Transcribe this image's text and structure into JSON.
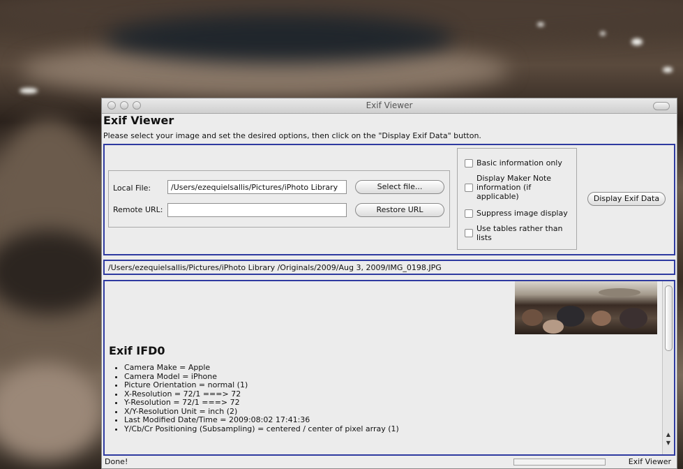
{
  "window": {
    "title": "Exif Viewer"
  },
  "header": {
    "app_title": "Exif Viewer",
    "instructions": "Please select your image and set the desired options, then click on the \"Display Exif Data\" button."
  },
  "form": {
    "local_file_label": "Local File:",
    "local_file_value": "/Users/ezequielsallis/Pictures/iPhoto Library",
    "remote_url_label": "Remote URL:",
    "remote_url_value": "",
    "select_file_button": "Select file...",
    "restore_url_button": "Restore URL",
    "display_button": "Display Exif Data"
  },
  "options": [
    {
      "label": "Basic information only",
      "checked": false
    },
    {
      "label": "Display Maker Note information (if applicable)",
      "checked": false
    },
    {
      "label": "Suppress image display",
      "checked": false
    },
    {
      "label": "Use tables rather than lists",
      "checked": false
    }
  ],
  "path_display": "/Users/ezequielsallis/Pictures/iPhoto Library /Originals/2009/Aug 3, 2009/IMG_0198.JPG",
  "results": {
    "section_title": "Exif IFD0",
    "items": [
      "Camera Make = Apple",
      "Camera Model = iPhone",
      "Picture Orientation = normal (1)",
      "X-Resolution = 72/1 ===> 72",
      "Y-Resolution = 72/1 ===> 72",
      "X/Y-Resolution Unit = inch (2)",
      "Last Modified Date/Time = 2009:08:02 17:41:36",
      "Y/Cb/Cr Positioning (Subsampling) = centered / center of pixel array (1)"
    ]
  },
  "status": {
    "text": "Done!",
    "app_name": "Exif Viewer"
  },
  "colors": {
    "panel_border": "#2e3aa0",
    "window_bg": "#ececec"
  }
}
